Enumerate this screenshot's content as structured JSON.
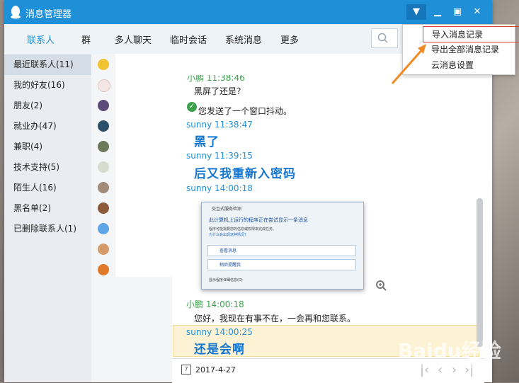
{
  "window": {
    "title": "消息管理器"
  },
  "nav": {
    "tabs": [
      "联系人",
      "群",
      "多人聊天",
      "临时会话",
      "系统消息",
      "更多"
    ],
    "active_color": "#1f8fd8"
  },
  "sidebar": {
    "items": [
      "最近联系人(11)",
      "我的好友(16)",
      "朋友(2)",
      "就业办(47)",
      "兼职(4)",
      "技术支持(5)",
      "陌生人(16)",
      "黑名单(2)",
      "已删除联系人(1)"
    ]
  },
  "menu": {
    "items": [
      "导入消息记录",
      "导出全部消息记录",
      "云消息设置"
    ]
  },
  "chat": {
    "partial_top": "小鹏 11:38:46",
    "m1_text": "黑屏了还是？",
    "m2_text": "您发送了一个窗口抖动。",
    "m3_head": "sunny 11:38:47",
    "m3_text": "黑了",
    "m4_head": "sunny 11:39:15",
    "m4_text": "后又我重新入密码",
    "m5_head": "sunny 14:00:18",
    "m6_head": "小鹏 14:00:18",
    "m6_text": "您好，我现在有事不在，一会再和您联系。",
    "m7_head": "sunny 14:00:25",
    "m7_text": "还是会啊"
  },
  "screenshot": {
    "title": "交互式服务检测",
    "heading": "此计算机上运行的程序正在尝试显示一条消息",
    "body": "程序可能需要您的信息或权限来完成任务。",
    "link": "为什么会出现这种情况?",
    "opt1": "查看消息",
    "opt2": "稍后提醒我",
    "footer": "显示程序详细信息(D)"
  },
  "footer": {
    "date": "2017-4-27"
  },
  "watermark": {
    "main": "Baidu经验",
    "sub": "jingyan.baidu.com"
  }
}
